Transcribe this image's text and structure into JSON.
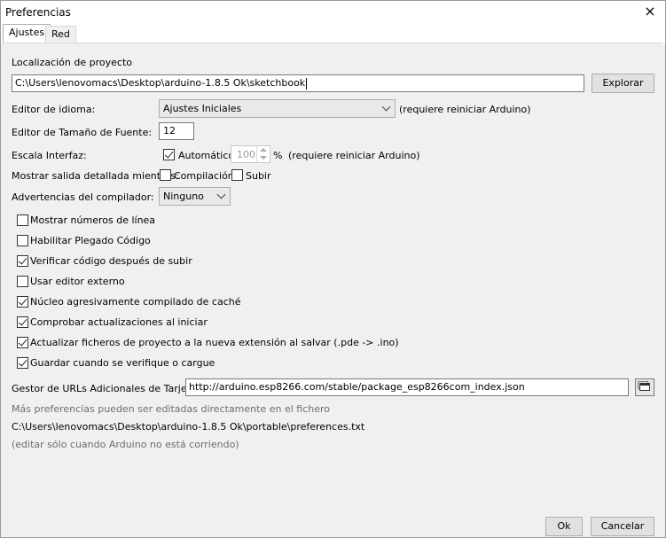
{
  "window": {
    "title": "Preferencias",
    "close_icon": "×"
  },
  "tabs": [
    {
      "label": "Ajustes"
    },
    {
      "label": "Red"
    }
  ],
  "sketchbook": {
    "label": "Localización de proyecto",
    "value": "C:\\Users\\lenovomacs\\Desktop\\arduino-1.8.5 Ok\\sketchbook",
    "browse_label": "Explorar"
  },
  "language": {
    "label": "Editor de idioma:",
    "value": "Ajustes Iniciales",
    "note": "(requiere reiniciar Arduino)"
  },
  "font_size": {
    "label": "Editor de Tamaño de Fuente:",
    "value": "12"
  },
  "scale": {
    "label": "Escala Interfaz:",
    "auto_label": "Automático",
    "auto_checked": true,
    "value": "100",
    "unit": "%",
    "note": "(requiere reiniciar Arduino)"
  },
  "verbose": {
    "label": "Mostrar salida detallada mientras:",
    "compile_label": "Compilación",
    "compile_checked": false,
    "upload_label": "Subir",
    "upload_checked": false
  },
  "warnings": {
    "label": "Advertencias del compilador:",
    "value": "Ninguno"
  },
  "options": [
    {
      "label": "Mostrar números de línea",
      "checked": false
    },
    {
      "label": "Habilitar Plegado Código",
      "checked": false
    },
    {
      "label": "Verificar código después de subir",
      "checked": true
    },
    {
      "label": "Usar editor externo",
      "checked": false
    },
    {
      "label": "Núcleo agresivamente compilado de caché",
      "checked": true
    },
    {
      "label": "Comprobar actualizaciones al iniciar",
      "checked": true
    },
    {
      "label": "Actualizar ficheros de proyecto a la nueva extensión al salvar (.pde -> .ino)",
      "checked": true
    },
    {
      "label": "Guardar cuando se verifique o cargue",
      "checked": true
    }
  ],
  "board_urls": {
    "label": "Gestor de URLs Adicionales de Tarjetas:",
    "value": "http://arduino.esp8266.com/stable/package_esp8266com_index.json"
  },
  "more_prefs": {
    "line1": "Más preferencias pueden ser editadas directamente en el fichero",
    "path": "C:\\Users\\lenovomacs\\Desktop\\arduino-1.8.5 Ok\\portable\\preferences.txt",
    "line3": "(editar sólo cuando Arduino no está corriendo)"
  },
  "footer": {
    "ok_label": "Ok",
    "cancel_label": "Cancelar"
  }
}
